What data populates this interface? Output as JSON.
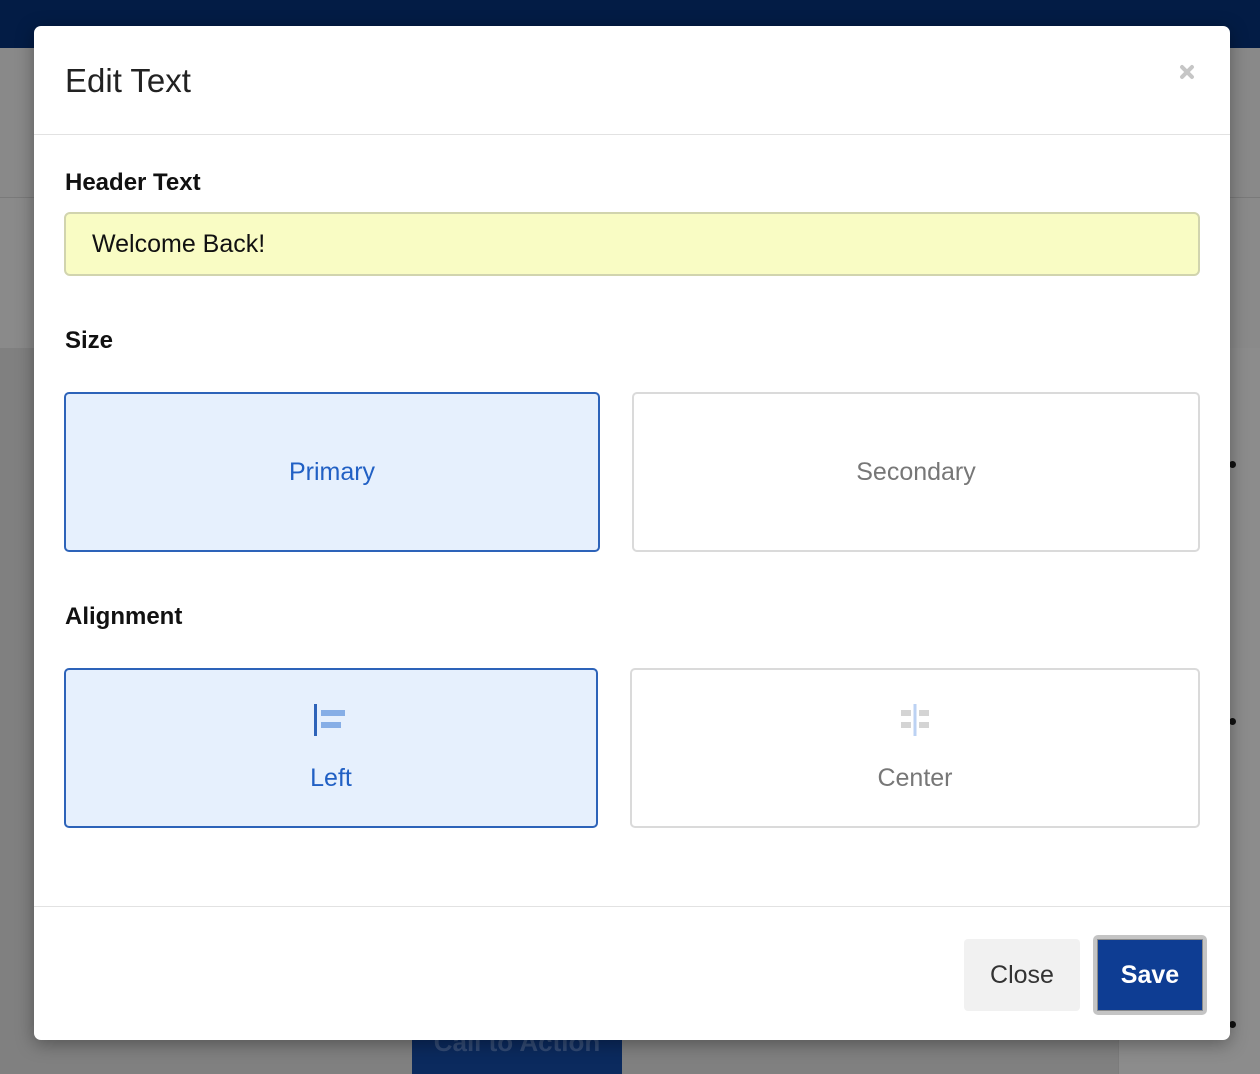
{
  "background": {
    "cta_label": "Call to Action"
  },
  "modal": {
    "title": "Edit Text",
    "close_icon": "close-icon"
  },
  "header_text": {
    "label": "Header Text",
    "value": "Welcome Back!"
  },
  "size": {
    "label": "Size",
    "options": [
      {
        "label": "Primary",
        "selected": true
      },
      {
        "label": "Secondary",
        "selected": false
      }
    ]
  },
  "alignment": {
    "label": "Alignment",
    "options": [
      {
        "label": "Left",
        "icon": "align-left-icon",
        "selected": true
      },
      {
        "label": "Center",
        "icon": "align-center-icon",
        "selected": false
      }
    ]
  },
  "footer": {
    "close_label": "Close",
    "save_label": "Save"
  },
  "colors": {
    "accent": "#2160c4",
    "selected_bg": "#e6f0fd",
    "save_button": "#0e3d93",
    "input_bg": "#f9fcc4",
    "topbar": "#031c45"
  }
}
